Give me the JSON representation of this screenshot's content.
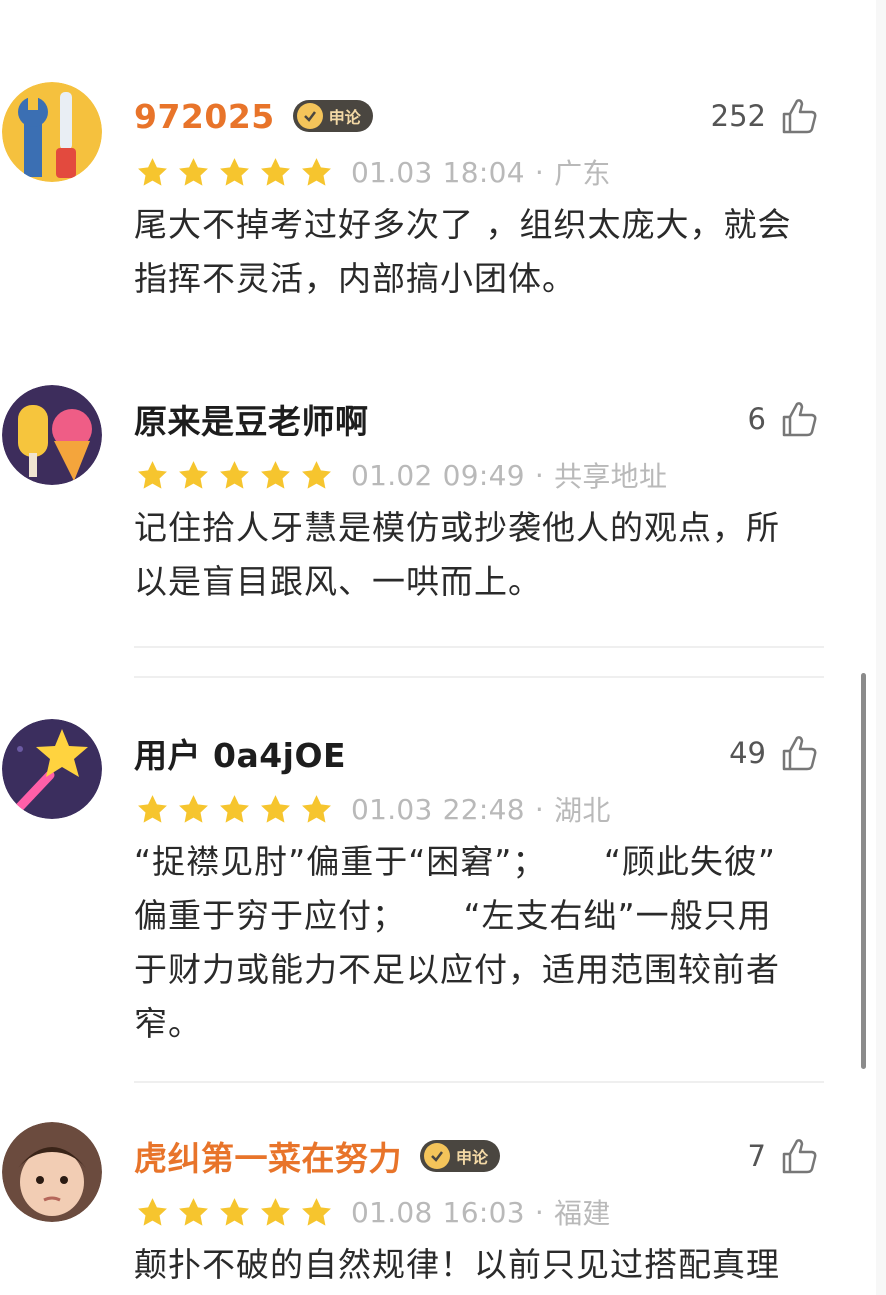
{
  "comments": [
    {
      "username": "972025",
      "badge": "申论",
      "likes": "252",
      "rating": 5,
      "date": "01.03",
      "time": "18:04",
      "location": "广东",
      "lines": [
        "尾大不掉考过好多次了 ，组织太庞大，就会",
        "指挥不灵活，内部搞小团体。"
      ]
    },
    {
      "username": "原来是豆老师啊",
      "likes": "6",
      "rating": 5,
      "date": "01.02",
      "time": "09:49",
      "location": "共享地址",
      "lines": [
        "记住拾人牙慧是模仿或抄袭他人的观点，所",
        "以是盲目跟风、一哄而上。"
      ]
    },
    {
      "username": "用户 0a4jOE",
      "likes": "49",
      "rating": 5,
      "date": "01.03",
      "time": "22:48",
      "location": "湖北",
      "lines": [
        "“捉襟见肘”偏重于“困窘”；     “顾此失彼”",
        "偏重于穷于应付；     “左支右绌”一般只用",
        "于财力或能力不足以应付，适用范围较前者",
        "窄。"
      ]
    },
    {
      "username": "虎纠第一菜在努力",
      "badge": "申论",
      "likes": "7",
      "rating": 5,
      "date": "01.08",
      "time": "16:03",
      "location": "福建",
      "lines": [
        "颠扑不破的自然规律！以前只见过搭配真理"
      ]
    }
  ],
  "icons": {
    "like": "thumbs-up-outline-icon",
    "star": "star-filled-icon",
    "badge": "shield-check-icon"
  },
  "colors": {
    "username_highlight": "#e8742a",
    "star": "#f6c52e",
    "meta": "#b9b9b9"
  }
}
